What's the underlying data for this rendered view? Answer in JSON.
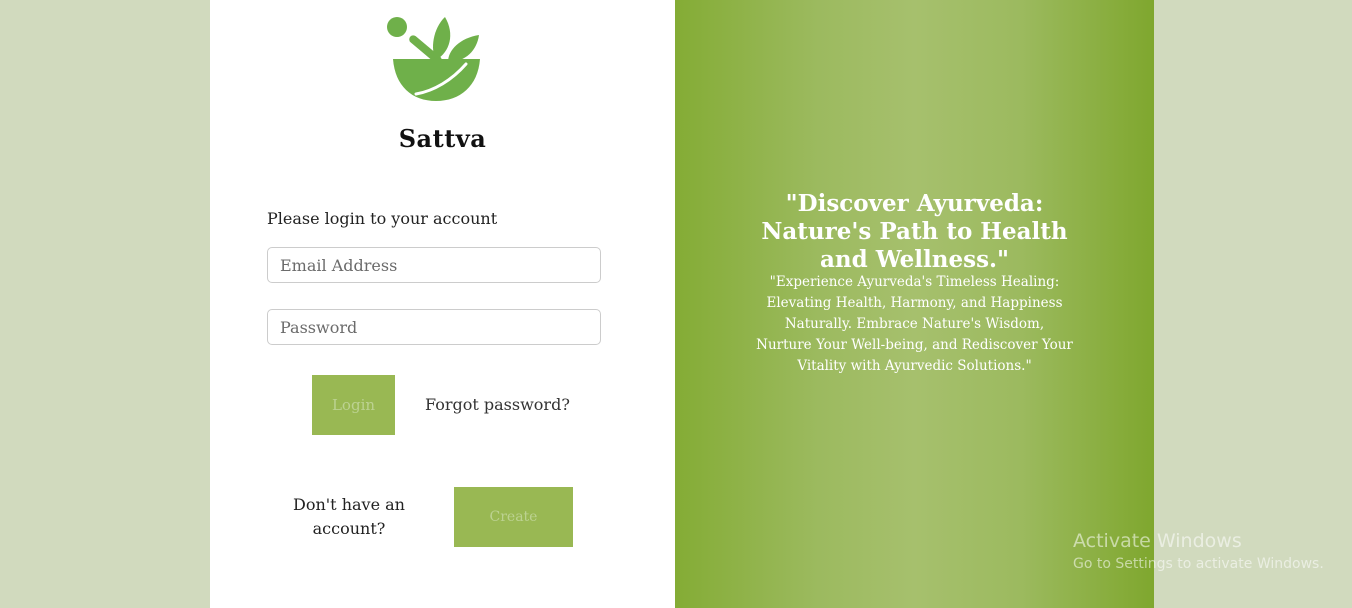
{
  "brand": {
    "name": "Sattva",
    "logo_icon": "mortar-pestle-leaf-icon",
    "logo_color": "#6fb04a"
  },
  "login": {
    "prompt": "Please login to your account",
    "email_placeholder": "Email Address",
    "password_placeholder": "Password",
    "login_label": "Login",
    "forgot_label": "Forgot password?",
    "no_account_label": "Don't have an account?",
    "create_label": "Create"
  },
  "hero": {
    "headline": "\"Discover Ayurveda: Nature's Path to Health and Wellness.\"",
    "subtext": "\"Experience Ayurveda's Timeless Healing: Elevating Health, Harmony, and Happiness Naturally. Embrace Nature's Wisdom, Nurture Your Well-being, and Rediscover Your Vitality with Ayurvedic Solutions.\""
  },
  "watermark": {
    "title": "Activate Windows",
    "subtitle": "Go to Settings to activate Windows."
  },
  "colors": {
    "page_bg": "#d1dabe",
    "button": "#99b853",
    "panel_green": "#84ac35"
  }
}
